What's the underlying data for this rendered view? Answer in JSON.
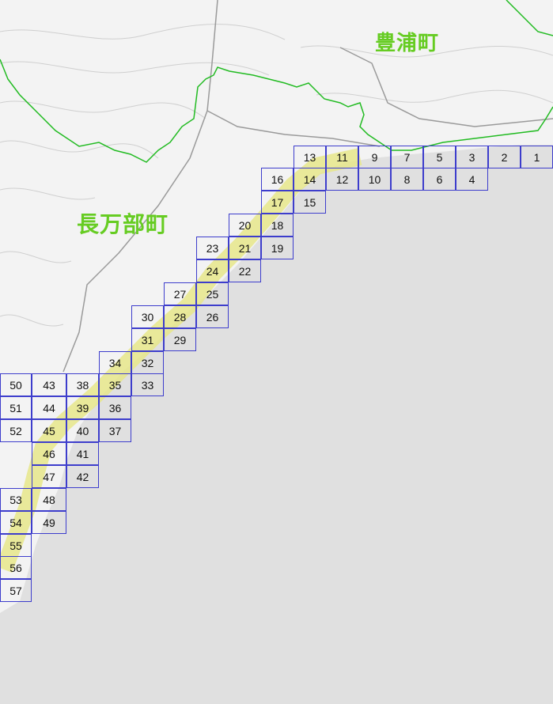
{
  "map": {
    "towns": {
      "toyoura": "豊浦町",
      "oshamambe": "長万部町"
    },
    "tiles": [
      "1",
      "2",
      "3",
      "4",
      "5",
      "6",
      "7",
      "8",
      "9",
      "10",
      "11",
      "12",
      "13",
      "14",
      "15",
      "16",
      "17",
      "18",
      "19",
      "20",
      "21",
      "22",
      "23",
      "24",
      "25",
      "26",
      "27",
      "28",
      "29",
      "30",
      "31",
      "32",
      "33",
      "34",
      "35",
      "36",
      "37",
      "38",
      "39",
      "40",
      "41",
      "42",
      "43",
      "44",
      "45",
      "46",
      "47",
      "48",
      "49",
      "50",
      "51",
      "52",
      "53",
      "54",
      "55",
      "56",
      "57"
    ],
    "colors": {
      "sea": "#e0e0e0",
      "land": "#f3f3f3",
      "tile_border": "#3d3dcc",
      "boundary": "#22bb22",
      "route_highlight": "#e6e68a",
      "town_label": "#66cc22"
    }
  }
}
